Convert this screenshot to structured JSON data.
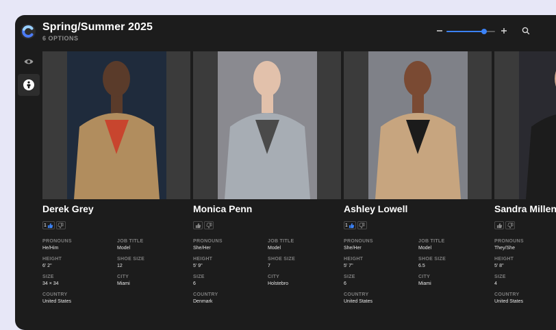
{
  "header": {
    "title": "Spring/Summer 2025",
    "subtitle": "6 OPTIONS",
    "zoom_level": 0.78
  },
  "sidebar": {
    "items": [
      {
        "icon": "eye-icon",
        "active": false
      },
      {
        "icon": "person-icon",
        "active": true
      }
    ]
  },
  "labels": {
    "pronouns": "PRONOUNS",
    "job_title": "JOB TITLE",
    "height": "HEIGHT",
    "shoe_size": "SHOE SIZE",
    "size": "SIZE",
    "city": "CITY",
    "country": "COUNTRY"
  },
  "options": [
    {
      "name": "Derek Grey",
      "likes": "1",
      "liked": true,
      "pronouns": "He/Him",
      "job_title": "Model",
      "height": "6' 2\"",
      "shoe_size": "12",
      "size": "34 × 34",
      "city": "Miami",
      "country": "United States",
      "tone": "#1f2b3c",
      "coat": "#b18d5e",
      "skin": "#5a3b2a",
      "shirt": "#c8452e"
    },
    {
      "name": "Monica Penn",
      "likes": "",
      "liked": false,
      "pronouns": "She/Her",
      "job_title": "Model",
      "height": "5' 9\"",
      "shoe_size": "7",
      "size": "6",
      "city": "Holstebro",
      "country": "Denmark",
      "tone": "#8a8a90",
      "coat": "#a7adb4",
      "skin": "#e2c1ab",
      "shirt": "#4a4a4a"
    },
    {
      "name": "Ashley Lowell",
      "likes": "1",
      "liked": true,
      "pronouns": "She/Her",
      "job_title": "Model",
      "height": "5' 7\"",
      "shoe_size": "6.5",
      "size": "6",
      "city": "Miami",
      "country": "United States",
      "tone": "#7f8188",
      "coat": "#c7a57f",
      "skin": "#7a4a33",
      "shirt": "#1b1b1b"
    },
    {
      "name": "Sandra Millen",
      "likes": "",
      "liked": false,
      "pronouns": "They/She",
      "job_title": "",
      "height": "5' 8\"",
      "shoe_size": "",
      "size": "4",
      "city": "",
      "country": "United States",
      "tone": "#2a2a30",
      "coat": "#1c1c1c",
      "skin": "#cfa58c",
      "shirt": "#111111"
    }
  ]
}
